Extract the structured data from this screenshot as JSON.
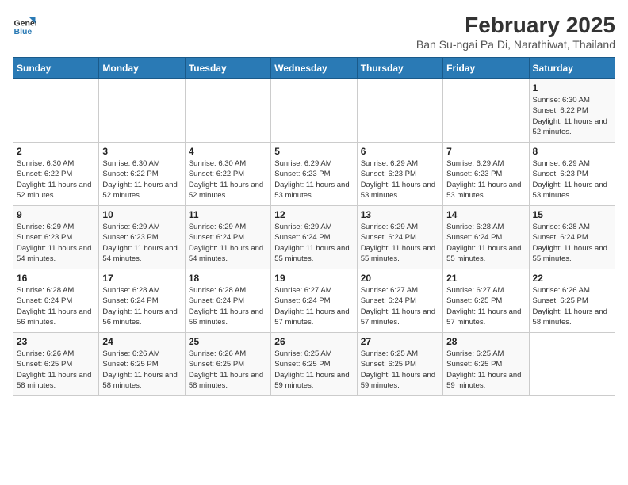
{
  "logo": {
    "line1": "General",
    "line2": "Blue"
  },
  "title": "February 2025",
  "subtitle": "Ban Su-ngai Pa Di, Narathiwat, Thailand",
  "days_of_week": [
    "Sunday",
    "Monday",
    "Tuesday",
    "Wednesday",
    "Thursday",
    "Friday",
    "Saturday"
  ],
  "weeks": [
    [
      {
        "day": "",
        "info": ""
      },
      {
        "day": "",
        "info": ""
      },
      {
        "day": "",
        "info": ""
      },
      {
        "day": "",
        "info": ""
      },
      {
        "day": "",
        "info": ""
      },
      {
        "day": "",
        "info": ""
      },
      {
        "day": "1",
        "info": "Sunrise: 6:30 AM\nSunset: 6:22 PM\nDaylight: 11 hours and 52 minutes."
      }
    ],
    [
      {
        "day": "2",
        "info": "Sunrise: 6:30 AM\nSunset: 6:22 PM\nDaylight: 11 hours and 52 minutes."
      },
      {
        "day": "3",
        "info": "Sunrise: 6:30 AM\nSunset: 6:22 PM\nDaylight: 11 hours and 52 minutes."
      },
      {
        "day": "4",
        "info": "Sunrise: 6:30 AM\nSunset: 6:22 PM\nDaylight: 11 hours and 52 minutes."
      },
      {
        "day": "5",
        "info": "Sunrise: 6:29 AM\nSunset: 6:23 PM\nDaylight: 11 hours and 53 minutes."
      },
      {
        "day": "6",
        "info": "Sunrise: 6:29 AM\nSunset: 6:23 PM\nDaylight: 11 hours and 53 minutes."
      },
      {
        "day": "7",
        "info": "Sunrise: 6:29 AM\nSunset: 6:23 PM\nDaylight: 11 hours and 53 minutes."
      },
      {
        "day": "8",
        "info": "Sunrise: 6:29 AM\nSunset: 6:23 PM\nDaylight: 11 hours and 53 minutes."
      }
    ],
    [
      {
        "day": "9",
        "info": "Sunrise: 6:29 AM\nSunset: 6:23 PM\nDaylight: 11 hours and 54 minutes."
      },
      {
        "day": "10",
        "info": "Sunrise: 6:29 AM\nSunset: 6:23 PM\nDaylight: 11 hours and 54 minutes."
      },
      {
        "day": "11",
        "info": "Sunrise: 6:29 AM\nSunset: 6:24 PM\nDaylight: 11 hours and 54 minutes."
      },
      {
        "day": "12",
        "info": "Sunrise: 6:29 AM\nSunset: 6:24 PM\nDaylight: 11 hours and 55 minutes."
      },
      {
        "day": "13",
        "info": "Sunrise: 6:29 AM\nSunset: 6:24 PM\nDaylight: 11 hours and 55 minutes."
      },
      {
        "day": "14",
        "info": "Sunrise: 6:28 AM\nSunset: 6:24 PM\nDaylight: 11 hours and 55 minutes."
      },
      {
        "day": "15",
        "info": "Sunrise: 6:28 AM\nSunset: 6:24 PM\nDaylight: 11 hours and 55 minutes."
      }
    ],
    [
      {
        "day": "16",
        "info": "Sunrise: 6:28 AM\nSunset: 6:24 PM\nDaylight: 11 hours and 56 minutes."
      },
      {
        "day": "17",
        "info": "Sunrise: 6:28 AM\nSunset: 6:24 PM\nDaylight: 11 hours and 56 minutes."
      },
      {
        "day": "18",
        "info": "Sunrise: 6:28 AM\nSunset: 6:24 PM\nDaylight: 11 hours and 56 minutes."
      },
      {
        "day": "19",
        "info": "Sunrise: 6:27 AM\nSunset: 6:24 PM\nDaylight: 11 hours and 57 minutes."
      },
      {
        "day": "20",
        "info": "Sunrise: 6:27 AM\nSunset: 6:24 PM\nDaylight: 11 hours and 57 minutes."
      },
      {
        "day": "21",
        "info": "Sunrise: 6:27 AM\nSunset: 6:25 PM\nDaylight: 11 hours and 57 minutes."
      },
      {
        "day": "22",
        "info": "Sunrise: 6:26 AM\nSunset: 6:25 PM\nDaylight: 11 hours and 58 minutes."
      }
    ],
    [
      {
        "day": "23",
        "info": "Sunrise: 6:26 AM\nSunset: 6:25 PM\nDaylight: 11 hours and 58 minutes."
      },
      {
        "day": "24",
        "info": "Sunrise: 6:26 AM\nSunset: 6:25 PM\nDaylight: 11 hours and 58 minutes."
      },
      {
        "day": "25",
        "info": "Sunrise: 6:26 AM\nSunset: 6:25 PM\nDaylight: 11 hours and 58 minutes."
      },
      {
        "day": "26",
        "info": "Sunrise: 6:25 AM\nSunset: 6:25 PM\nDaylight: 11 hours and 59 minutes."
      },
      {
        "day": "27",
        "info": "Sunrise: 6:25 AM\nSunset: 6:25 PM\nDaylight: 11 hours and 59 minutes."
      },
      {
        "day": "28",
        "info": "Sunrise: 6:25 AM\nSunset: 6:25 PM\nDaylight: 11 hours and 59 minutes."
      },
      {
        "day": "",
        "info": ""
      }
    ]
  ]
}
